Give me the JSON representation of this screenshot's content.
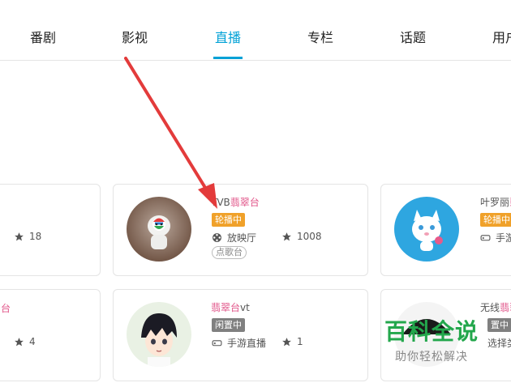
{
  "tabs": [
    "番剧",
    "影视",
    "直播",
    "专栏",
    "话题",
    "用户"
  ],
  "active_tab_index": 2,
  "colors": {
    "accent": "#00a1d6",
    "name_highlight": "#e15589",
    "badge_orange": "#f0a12a",
    "badge_gray": "#808080",
    "watermark": "#23a74c"
  },
  "cards": [
    {
      "star_count": "18"
    },
    {
      "name_prefix": "TVB",
      "name_highlight": "翡翠台",
      "status": "轮播中",
      "category": "放映厅",
      "star_count": "1008",
      "tag": "点歌台"
    },
    {
      "name_prefix": "叶罗丽",
      "name_highlight": "翡",
      "status": "轮播中",
      "category": "手游"
    },
    {
      "name_highlight": "台",
      "star_count": "4"
    },
    {
      "name_highlight": "翡翠台",
      "name_suffix": "vt",
      "status": "闲置中",
      "category": "手游直播",
      "star_count": "1"
    },
    {
      "name_prefix": "无线",
      "name_highlight": "翡翠",
      "status": "置中",
      "category": "选择类"
    }
  ],
  "watermark": {
    "title": "百科全说",
    "subtitle": "助你轻松解决"
  }
}
